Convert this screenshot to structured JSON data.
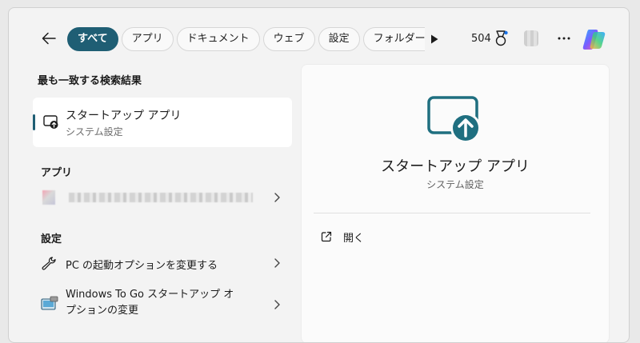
{
  "topbar": {
    "back_icon": "arrow-left-icon",
    "chips": [
      {
        "label": "すべて",
        "active": true
      },
      {
        "label": "アプリ",
        "active": false
      },
      {
        "label": "ドキュメント",
        "active": false
      },
      {
        "label": "ウェブ",
        "active": false
      },
      {
        "label": "設定",
        "active": false
      },
      {
        "label": "フォルダー",
        "active": false
      }
    ],
    "more_chips_icon": "play-icon",
    "points": "504",
    "rewards_icon": "medal-icon",
    "more_icon": "more-horizontal-icon",
    "copilot_icon": "copilot-icon"
  },
  "results": {
    "best_match_title": "最も一致する検索結果",
    "best_match": {
      "title": "スタートアップ アプリ",
      "subtitle": "システム設定",
      "icon": "startup-apps-icon"
    },
    "apps_title": "アプリ",
    "settings_title": "設定",
    "settings_items": [
      {
        "label": "PC の起動オプションを変更する",
        "icon": "wrench-icon"
      },
      {
        "label_line1": "Windows To Go スタートアップ オ",
        "label_line2": "プションの変更",
        "icon": "windows-to-go-icon"
      }
    ]
  },
  "detail": {
    "title": "スタートアップ アプリ",
    "subtitle": "システム設定",
    "open_label": "開く",
    "open_icon": "open-external-icon"
  },
  "colors": {
    "accent": "#1f5e74",
    "icon_teal": "#1f7a8c",
    "background": "#f3f3f3",
    "card": "#ffffff"
  }
}
